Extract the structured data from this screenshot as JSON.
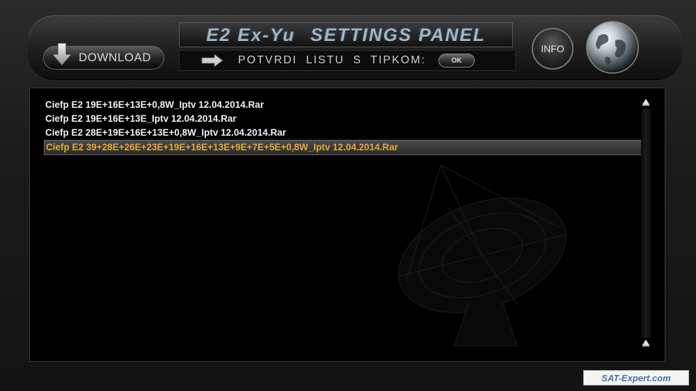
{
  "header": {
    "title_left": "E2 Ex-Yu",
    "title_right": "SETTINGS PANEL",
    "download_label": "DOWNLOAD",
    "confirm_text": "POTVRDI LISTU S TIPKOM:",
    "ok_label": "OK",
    "info_label": "INFO"
  },
  "file_list": {
    "selected_index": 3,
    "items": [
      "Ciefp E2 19E+16E+13E+0,8W_Iptv 12.04.2014.Rar",
      "Ciefp E2 19E+16E+13E_Iptv 12.04.2014.Rar",
      "Ciefp E2 28E+19E+16E+13E+0,8W_Iptv 12.04.2014.Rar",
      "Ciefp E2 39+28E+26E+23E+19E+16E+13E+9E+7E+5E+0,8W_Iptv 12.04.2014.Rar"
    ]
  },
  "watermark": "SAT-Expert.com",
  "colors": {
    "selected_text": "#e8a833",
    "title_text": "#9fb7c7",
    "list_text": "#f2f2f2"
  }
}
